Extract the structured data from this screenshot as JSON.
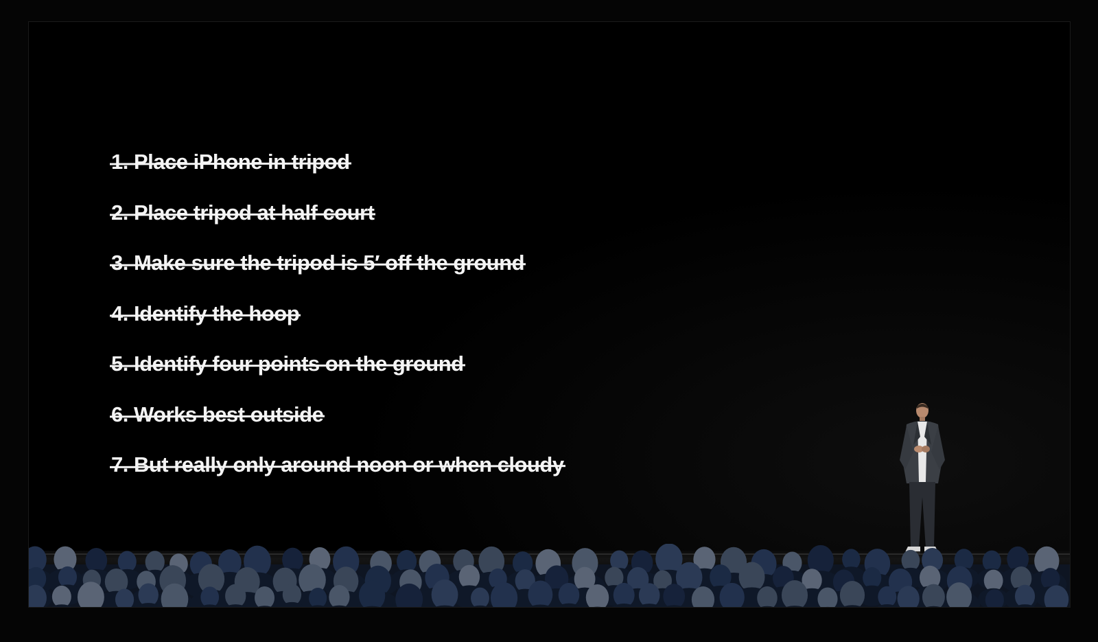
{
  "slide": {
    "checklist": [
      "1. Place iPhone in tripod",
      "2. Place tripod at half court",
      "3. Make sure the tripod is 5′ off the ground",
      "4. Identify the hoop",
      "5. Identify four points on the ground",
      "6. Works best outside",
      "7. But really only around noon or when cloudy"
    ]
  },
  "colors": {
    "background": "#000000",
    "text": "#f4f4f4",
    "audience": "#1b2a44"
  }
}
